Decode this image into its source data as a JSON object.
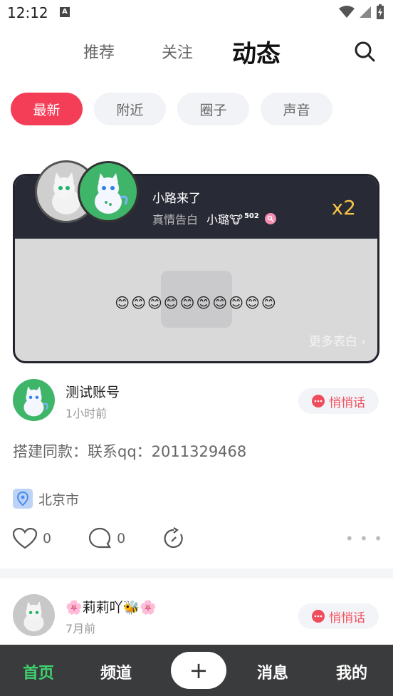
{
  "status": {
    "time": "12:12",
    "a_badge": "A"
  },
  "top_tabs": [
    {
      "label": "推荐"
    },
    {
      "label": "关注"
    },
    {
      "label": "动态",
      "active": true
    }
  ],
  "chips": [
    {
      "label": "最新",
      "active": true
    },
    {
      "label": "附近"
    },
    {
      "label": "圈子"
    },
    {
      "label": "声音"
    }
  ],
  "confession": {
    "from_name": "小路来了",
    "subtitle": "真情告白",
    "to_name": "小璐🐮",
    "to_score": "502",
    "multiplier": "x2",
    "emojis": "😊😊😊😊😊😊😊😊😊😊",
    "more_label": "更多表白 ›"
  },
  "posts": [
    {
      "name": "测试账号",
      "time": "1小时前",
      "whisper_label": "悄悄话",
      "text": "搭建同款：联系qq：2011329468",
      "location": "北京市",
      "likes": "0",
      "comments": "0"
    },
    {
      "name": "🌸莉莉吖🐝🌸",
      "time": "7月前",
      "whisper_label": "悄悄话"
    }
  ],
  "bottom_nav": {
    "home": "首页",
    "channel": "频道",
    "add": "+",
    "messages": "消息",
    "mine": "我的"
  },
  "colors": {
    "accent": "#f43d57",
    "nav_active": "#3dd36d",
    "multiplier": "#f6c445"
  }
}
